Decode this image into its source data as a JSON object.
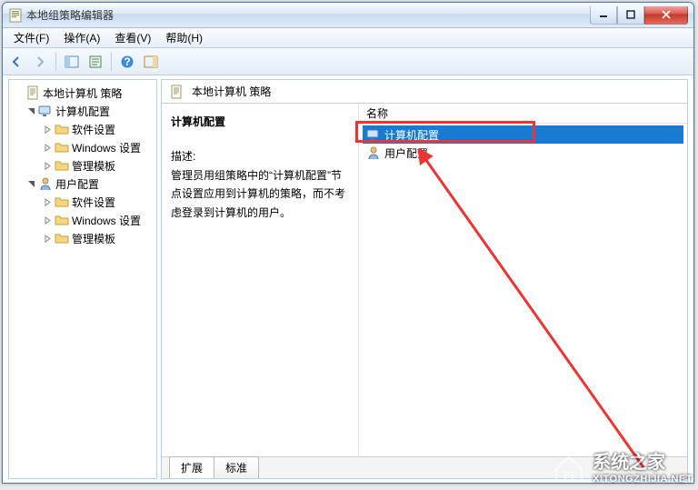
{
  "window": {
    "title": "本地组策略编辑器"
  },
  "menu": {
    "file": "文件(F)",
    "action": "操作(A)",
    "view": "查看(V)",
    "help": "帮助(H)"
  },
  "tree": {
    "root": "本地计算机 策略",
    "computer": {
      "label": "计算机配置",
      "software": "软件设置",
      "windows": "Windows 设置",
      "admin": "管理模板"
    },
    "user": {
      "label": "用户配置",
      "software": "软件设置",
      "windows": "Windows 设置",
      "admin": "管理模板"
    }
  },
  "right": {
    "header": "本地计算机 策略",
    "heading": "计算机配置",
    "desc_label": "描述:",
    "desc_text": "管理员用组策略中的“计算机配置”节点设置应用到计算机的策略，而不考虑登录到计算机的用户。",
    "col_name": "名称",
    "items": {
      "computer": "计算机配置",
      "user": "用户配置"
    }
  },
  "tabs": {
    "extended": "扩展",
    "standard": "标准"
  },
  "watermark": {
    "zh": "系统之家",
    "url": "XITONGZHIJIA.NET"
  }
}
